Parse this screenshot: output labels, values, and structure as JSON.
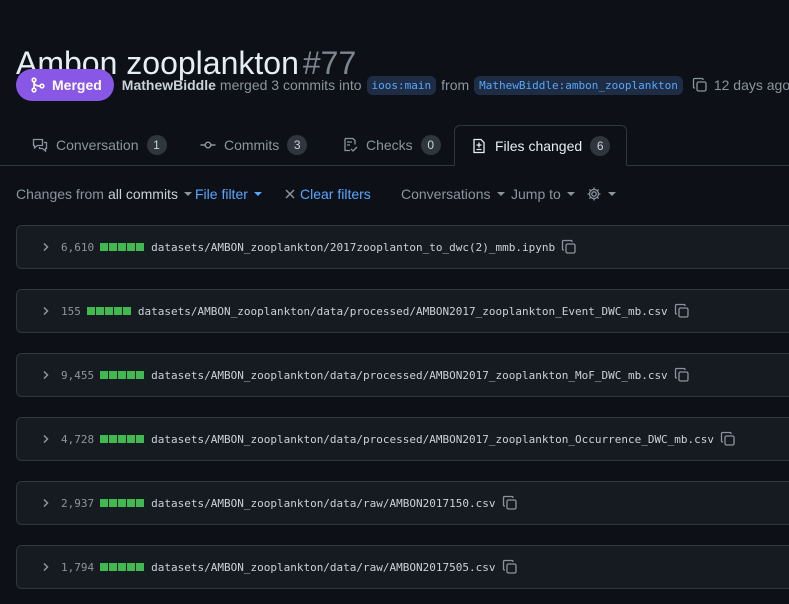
{
  "pr": {
    "title": "Ambon zooplankton",
    "number": "#77",
    "state": "Merged",
    "author": "MathewBiddle",
    "action_text": "merged 3 commits into",
    "base_branch": "ioos:main",
    "from_text": "from",
    "head_branch": "MathewBiddle:ambon_zooplankton",
    "time": "12 days ago"
  },
  "tabs": [
    {
      "label": "Conversation",
      "count": "1",
      "icon": "comment-icon"
    },
    {
      "label": "Commits",
      "count": "3",
      "icon": "commit-icon"
    },
    {
      "label": "Checks",
      "count": "0",
      "icon": "checklist-icon"
    },
    {
      "label": "Files changed",
      "count": "6",
      "icon": "file-diff-icon",
      "active": true
    }
  ],
  "toolbar": {
    "changes_from_prefix": "Changes from",
    "changes_from_value": "all commits",
    "file_filter": "File filter",
    "clear_filters": "Clear filters",
    "conversations": "Conversations",
    "jump_to": "Jump to"
  },
  "files": [
    {
      "changes": "6,610",
      "path": "datasets/AMBON_zooplankton/2017zooplanton_to_dwc(2)_mmb.ipynb"
    },
    {
      "changes": "155",
      "path": "datasets/AMBON_zooplankton/data/processed/AMBON2017_zooplankton_Event_DWC_mb.csv"
    },
    {
      "changes": "9,455",
      "path": "datasets/AMBON_zooplankton/data/processed/AMBON2017_zooplankton_MoF_DWC_mb.csv"
    },
    {
      "changes": "4,728",
      "path": "datasets/AMBON_zooplankton/data/processed/AMBON2017_zooplankton_Occurrence_DWC_mb.csv"
    },
    {
      "changes": "2,937",
      "path": "datasets/AMBON_zooplankton/data/raw/AMBON2017150.csv"
    },
    {
      "changes": "1,794",
      "path": "datasets/AMBON_zooplankton/data/raw/AMBON2017505.csv"
    }
  ],
  "colors": {
    "merged": "#8957e5",
    "link": "#58a6ff",
    "diff_added": "#3fb950"
  }
}
